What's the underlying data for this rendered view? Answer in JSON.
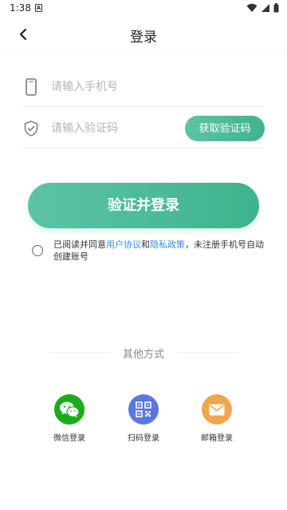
{
  "status_bar": {
    "time": "1:38",
    "notification_glyph": "A"
  },
  "header": {
    "title": "登录"
  },
  "phone_row": {
    "placeholder": "请输入手机号",
    "icon": "phone-icon"
  },
  "code_row": {
    "placeholder": "请输入验证码",
    "icon": "shield-check-icon",
    "button_label": "获取验证码"
  },
  "login_button": {
    "label": "验证并登录"
  },
  "agreement": {
    "prefix": "已阅读并同意",
    "user_agreement": "用户协议",
    "and": "和",
    "privacy_policy": "隐私政策",
    "suffix": "，未注册手机号自动创建账号"
  },
  "other_methods": {
    "title": "其他方式",
    "items": [
      {
        "label": "微信登录",
        "icon": "wechat-icon",
        "color": "#1aad19"
      },
      {
        "label": "扫码登录",
        "icon": "qr-code-icon",
        "color": "#5a77e0"
      },
      {
        "label": "邮箱登录",
        "icon": "mail-icon",
        "color": "#f0a64e"
      }
    ]
  },
  "colors": {
    "accent": "#3fb28e",
    "link": "#3b8be0"
  }
}
